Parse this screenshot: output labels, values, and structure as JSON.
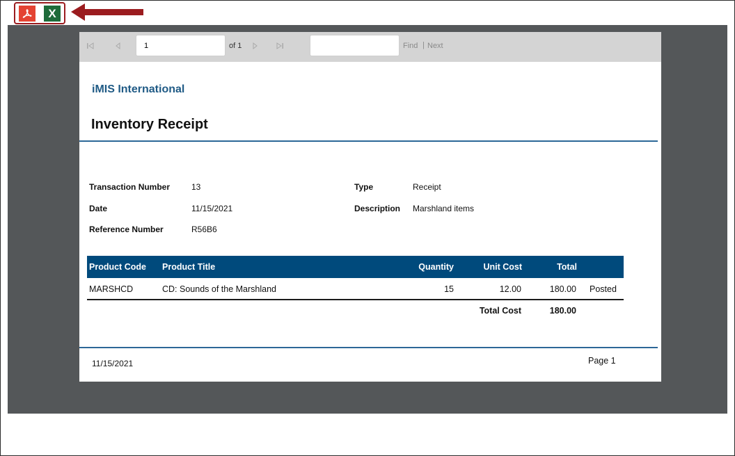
{
  "toolbar": {
    "export_pdf_icon": "pdf-icon",
    "export_excel_icon": "excel-icon",
    "excel_glyph": "X",
    "arrow_color": "#9b1c1f"
  },
  "pager": {
    "page_value": "1",
    "of_label": "of 1",
    "find_label": "Find",
    "separator": "|",
    "next_label": "Next",
    "find_value": ""
  },
  "report": {
    "org_name": "iMIS International",
    "title": "Inventory Receipt",
    "fields": {
      "transaction_number_label": "Transaction Number",
      "transaction_number": "13",
      "date_label": "Date",
      "date": "11/15/2021",
      "reference_number_label": "Reference Number",
      "reference_number": "R56B6",
      "type_label": "Type",
      "type": "Receipt",
      "description_label": "Description",
      "description": "Marshland items"
    },
    "table": {
      "headers": [
        "Product Code",
        "Product Title",
        "Quantity",
        "Unit Cost",
        "Total"
      ],
      "rows": [
        {
          "code": "MARSHCD",
          "title": "CD: Sounds of the Marshland",
          "quantity": "15",
          "unit_cost": "12.00",
          "total": "180.00",
          "status": "Posted"
        }
      ],
      "total_cost_label": "Total Cost",
      "total_cost": "180.00"
    },
    "footer": {
      "date": "11/15/2021",
      "page": "Page 1"
    }
  },
  "colors": {
    "header_bg": "#004a7c",
    "org_name": "#1f5a85",
    "viewer_bg": "#545759",
    "rule": "#2c6797"
  }
}
